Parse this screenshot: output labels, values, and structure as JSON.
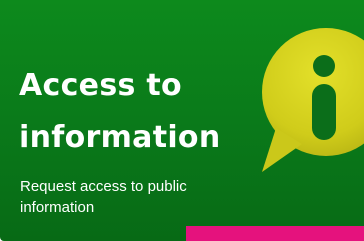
{
  "card": {
    "title": "Access to information",
    "description": "Request access to public information",
    "icon": "info-speech-bubble-icon"
  },
  "colors": {
    "background": "#0a7a1a",
    "icon_bubble": "#d4d21c",
    "icon_glyph": "#0b6e1a",
    "accent_bar": "#e5127d",
    "text": "#ffffff"
  }
}
